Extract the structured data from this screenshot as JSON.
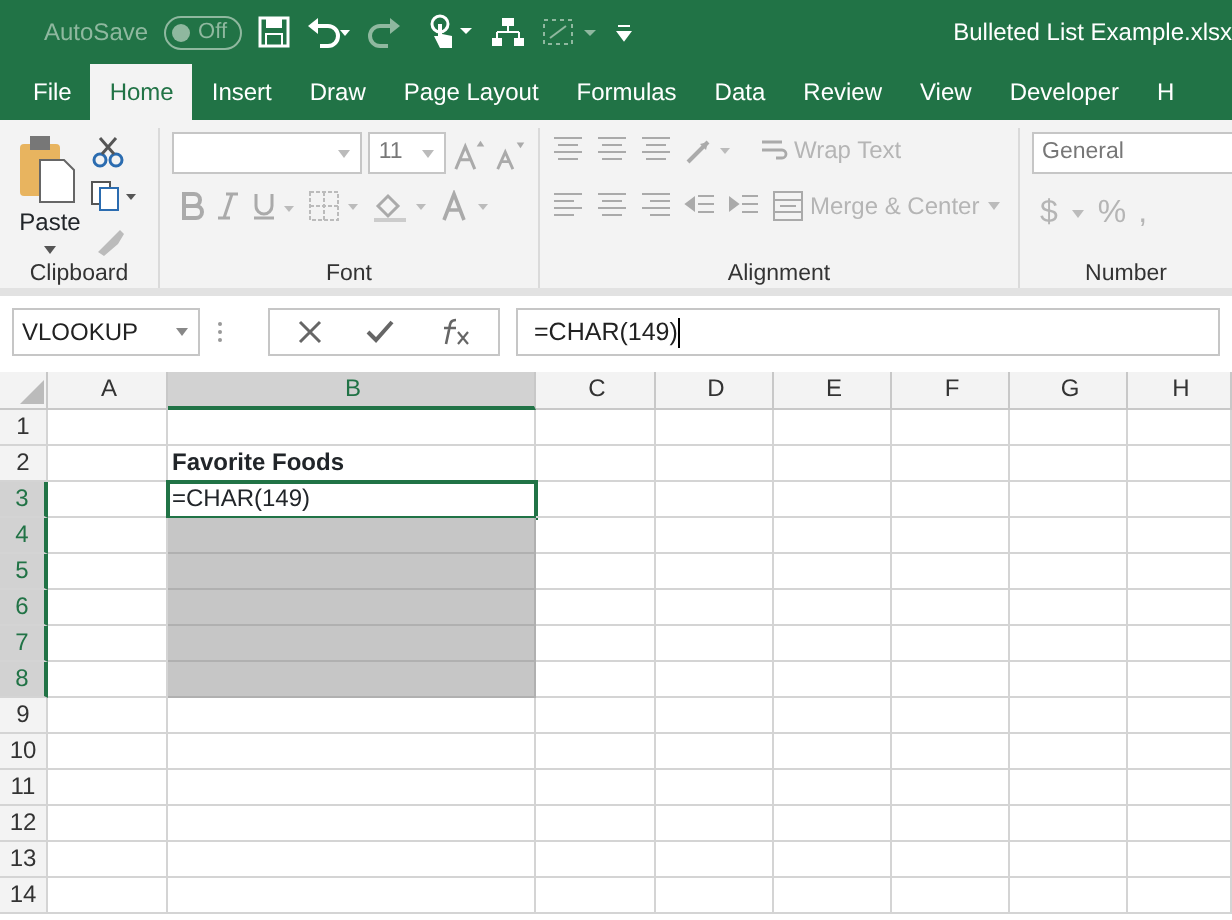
{
  "title_bar": {
    "autosave_label": "AutoSave",
    "autosave_toggle": {
      "label": "Off",
      "on": false
    },
    "file_name": "Bulleted List Example.xlsx"
  },
  "tabs": [
    {
      "label": "File",
      "selected": false
    },
    {
      "label": "Home",
      "selected": true
    },
    {
      "label": "Insert",
      "selected": false
    },
    {
      "label": "Draw",
      "selected": false
    },
    {
      "label": "Page Layout",
      "selected": false
    },
    {
      "label": "Formulas",
      "selected": false
    },
    {
      "label": "Data",
      "selected": false
    },
    {
      "label": "Review",
      "selected": false
    },
    {
      "label": "View",
      "selected": false
    },
    {
      "label": "Developer",
      "selected": false
    },
    {
      "label": "H",
      "selected": false
    }
  ],
  "ribbon": {
    "clipboard": {
      "paste_label": "Paste",
      "group_label": "Clipboard"
    },
    "font": {
      "font_size": "11",
      "group_label": "Font"
    },
    "alignment": {
      "wrap_text": "Wrap Text",
      "merge_center": "Merge & Center",
      "group_label": "Alignment"
    },
    "number": {
      "format": "General",
      "currency": "$",
      "percent": "%",
      "comma": ",",
      "group_label": "Number"
    }
  },
  "formula_bar": {
    "name_box": "VLOOKUP",
    "formula": "=CHAR(149)"
  },
  "sheet": {
    "columns": [
      {
        "label": "A",
        "selected": false
      },
      {
        "label": "B",
        "selected": true
      },
      {
        "label": "C",
        "selected": false
      },
      {
        "label": "D",
        "selected": false
      },
      {
        "label": "E",
        "selected": false
      },
      {
        "label": "F",
        "selected": false
      },
      {
        "label": "G",
        "selected": false
      },
      {
        "label": "H",
        "selected": false
      }
    ],
    "rows": [
      {
        "label": "1",
        "selected": false,
        "active": false
      },
      {
        "label": "2",
        "selected": false,
        "active": false,
        "column_b": {
          "text": "Favorite Foods",
          "bold": true
        }
      },
      {
        "label": "3",
        "selected": true,
        "active": true,
        "column_b": {
          "text": "=CHAR(149)",
          "bold": false
        }
      },
      {
        "label": "4",
        "selected": true,
        "active": false
      },
      {
        "label": "5",
        "selected": true,
        "active": false
      },
      {
        "label": "6",
        "selected": true,
        "active": false
      },
      {
        "label": "7",
        "selected": true,
        "active": false
      },
      {
        "label": "8",
        "selected": true,
        "active": false
      },
      {
        "label": "9",
        "selected": false,
        "active": false
      },
      {
        "label": "10",
        "selected": false,
        "active": false
      },
      {
        "label": "11",
        "selected": false,
        "active": false
      },
      {
        "label": "12",
        "selected": false,
        "active": false
      },
      {
        "label": "13",
        "selected": false,
        "active": false
      },
      {
        "label": "14",
        "selected": false,
        "active": false
      }
    ]
  }
}
